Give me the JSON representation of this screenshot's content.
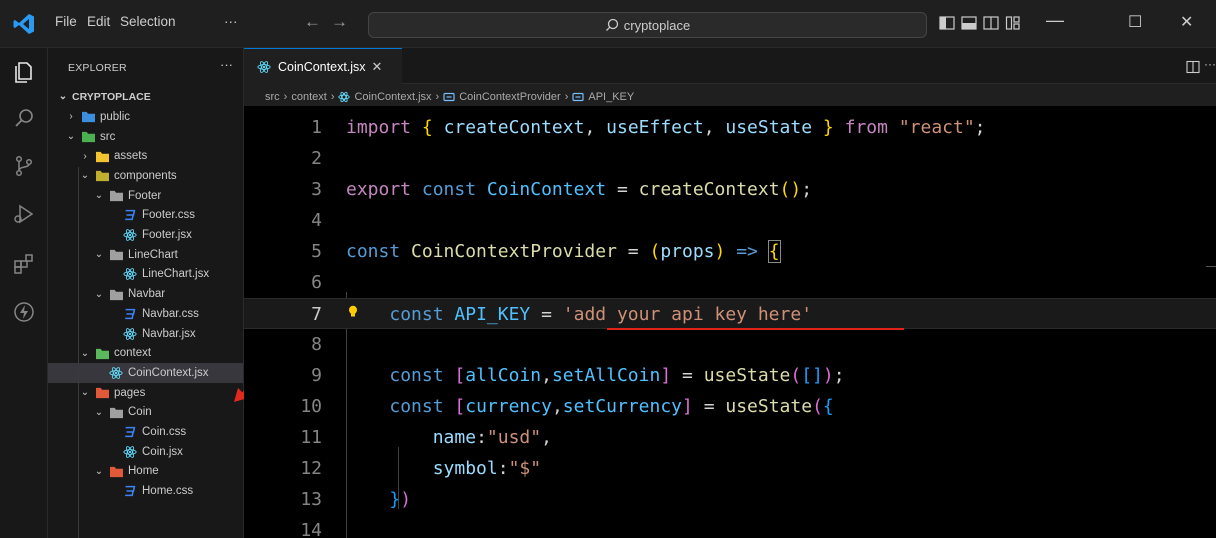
{
  "titlebar": {
    "menu": [
      "File",
      "Edit",
      "Selection",
      "···"
    ],
    "search": "cryptoplace",
    "window_controls": {
      "minimize": "—",
      "maximize": "☐",
      "close": "✕"
    }
  },
  "sidebar": {
    "header": "EXPLORER",
    "more": "···",
    "root": "CRYPTOPLACE",
    "items": [
      {
        "label": "public",
        "kind": "folder-special",
        "color": "#3c8fdc",
        "expanded": false,
        "depth": 0
      },
      {
        "label": "src",
        "kind": "folder-src",
        "color": "#4caf50",
        "expanded": true,
        "depth": 0
      },
      {
        "label": "assets",
        "kind": "folder",
        "color": "#f4c430",
        "expanded": false,
        "depth": 1
      },
      {
        "label": "components",
        "kind": "folder-components",
        "color": "#c0b030",
        "expanded": true,
        "depth": 1
      },
      {
        "label": "Footer",
        "kind": "folder-plain",
        "color": "#a0a0a0",
        "expanded": true,
        "depth": 2
      },
      {
        "label": "Footer.css",
        "kind": "css",
        "color": "#3b82f6",
        "depth": 3
      },
      {
        "label": "Footer.jsx",
        "kind": "react",
        "color": "#61dafb",
        "depth": 3
      },
      {
        "label": "LineChart",
        "kind": "folder-plain",
        "color": "#a0a0a0",
        "expanded": true,
        "depth": 2
      },
      {
        "label": "LineChart.jsx",
        "kind": "react",
        "color": "#61dafb",
        "depth": 3
      },
      {
        "label": "Navbar",
        "kind": "folder-plain",
        "color": "#a0a0a0",
        "expanded": true,
        "depth": 2
      },
      {
        "label": "Navbar.css",
        "kind": "css",
        "color": "#3b82f6",
        "depth": 3
      },
      {
        "label": "Navbar.jsx",
        "kind": "react",
        "color": "#61dafb",
        "depth": 3
      },
      {
        "label": "context",
        "kind": "folder-context",
        "color": "#5cb85c",
        "expanded": true,
        "depth": 1
      },
      {
        "label": "CoinContext.jsx",
        "kind": "react",
        "color": "#61dafb",
        "depth": 2,
        "active": true
      },
      {
        "label": "pages",
        "kind": "folder-pages",
        "color": "#e05a3a",
        "expanded": true,
        "depth": 1
      },
      {
        "label": "Coin",
        "kind": "folder-plain",
        "color": "#a0a0a0",
        "expanded": true,
        "depth": 2
      },
      {
        "label": "Coin.css",
        "kind": "css",
        "color": "#3b82f6",
        "depth": 3
      },
      {
        "label": "Coin.jsx",
        "kind": "react",
        "color": "#61dafb",
        "depth": 3
      },
      {
        "label": "Home",
        "kind": "folder-home",
        "color": "#e05a3a",
        "expanded": true,
        "depth": 2
      },
      {
        "label": "Home.css",
        "kind": "css",
        "color": "#3b82f6",
        "depth": 3
      }
    ]
  },
  "tabs": [
    {
      "label": "CoinContext.jsx",
      "close": "✕"
    }
  ],
  "breadcrumb": [
    "src",
    "context",
    "CoinContext.jsx",
    "CoinContextProvider",
    "API_KEY"
  ],
  "editor": {
    "line_numbers": [
      "1",
      "2",
      "3",
      "4",
      "5",
      "6",
      "7",
      "8",
      "9",
      "10",
      "11",
      "12",
      "13",
      "14"
    ],
    "current_line": 7,
    "colors": {
      "keyword": "#569cd6",
      "control": "#c586c0",
      "variable": "#9cdcfe",
      "constant": "#4fc1ff",
      "function": "#dcdcaa",
      "string": "#ce9178"
    }
  }
}
